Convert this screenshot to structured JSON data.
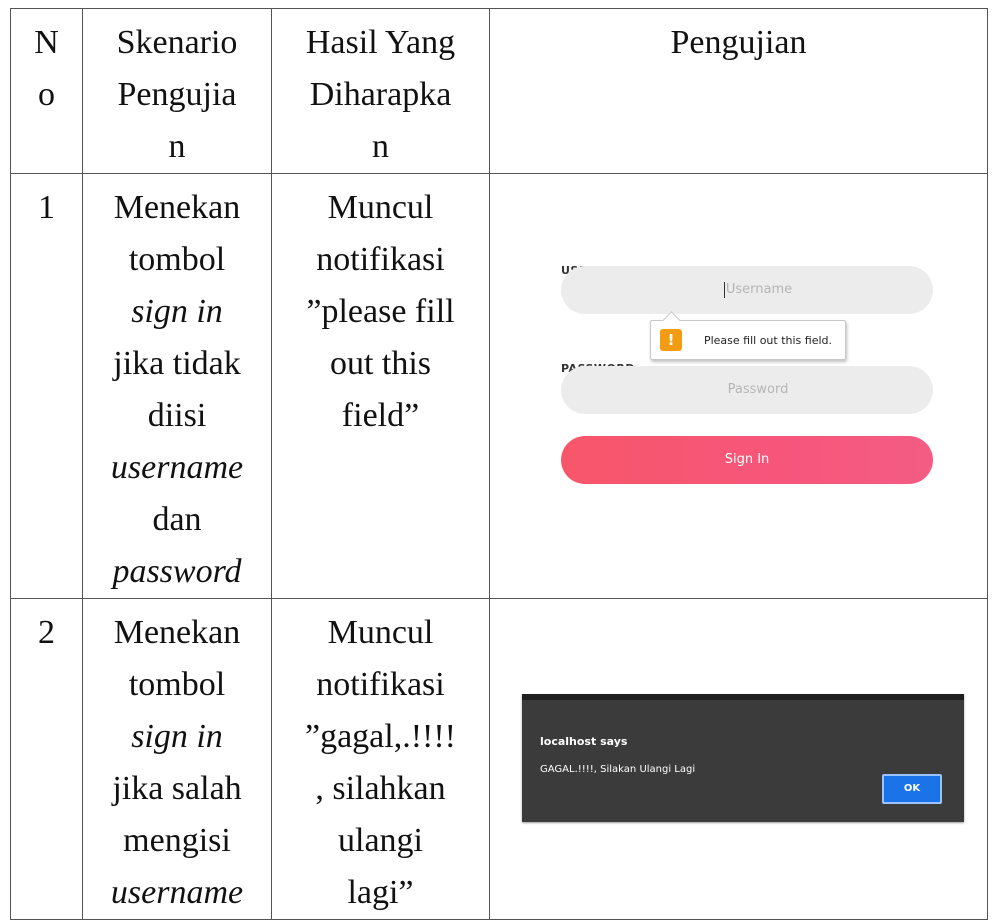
{
  "table": {
    "headers": {
      "no": [
        "N",
        "o"
      ],
      "skenario": [
        "Skenario",
        "Pengujia",
        "n"
      ],
      "hasil": [
        "Hasil Yang",
        "Diharapka",
        "n"
      ],
      "pengujian": "Pengujian"
    },
    "rows": [
      {
        "no": "1",
        "skenario": [
          "Menekan",
          "tombol",
          "sign in",
          "jika tidak",
          "diisi",
          "username",
          "dan",
          "password"
        ],
        "hasil": [
          "Muncul",
          "notifikasi",
          "”please fill",
          "out this",
          "field”"
        ],
        "screenshot": {
          "username_label": "USERNAME",
          "username_placeholder": "Username",
          "password_label": "PASSWORD",
          "password_placeholder": "Password",
          "tooltip_text": "Please fill out this field.",
          "tooltip_icon": "!",
          "signin_label": "Sign In"
        }
      },
      {
        "no": "2",
        "skenario": [
          "Menekan",
          "tombol",
          "sign in",
          "jika salah",
          "mengisi",
          "username"
        ],
        "hasil": [
          "Muncul",
          "notifikasi",
          "”gagal,.!!!!",
          ", silahkan",
          "ulangi",
          "lagi”"
        ],
        "screenshot": {
          "dialog_title": "localhost says",
          "dialog_message": "GAGAL.!!!!, Silakan Ulangi Lagi",
          "ok_label": "OK"
        }
      }
    ]
  },
  "colors": {
    "signin_button": "#f7566a",
    "warning_icon": "#f39c12",
    "dialog_background": "#3b3b3b",
    "ok_button": "#1a73e8"
  }
}
